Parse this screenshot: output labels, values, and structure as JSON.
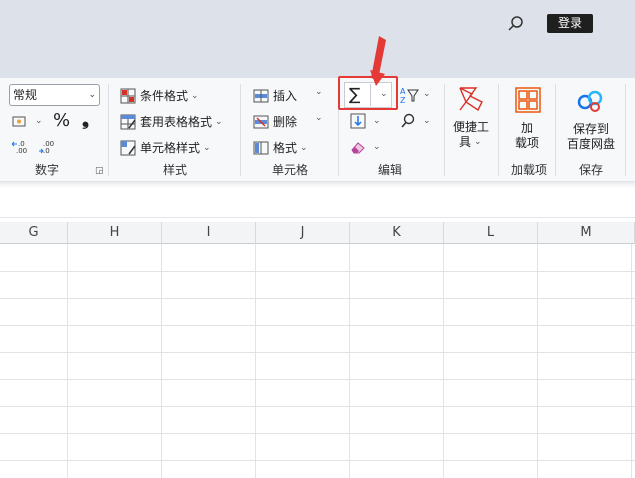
{
  "header": {
    "login_label": "登录"
  },
  "number_group": {
    "format_value": "常规",
    "percent_symbol": "%",
    "comma_symbol": "❟",
    "label": "数字"
  },
  "styles_group": {
    "items": [
      "条件格式",
      "套用表格格式",
      "单元格样式"
    ],
    "label": "样式"
  },
  "cells_group": {
    "items": [
      "插入",
      "删除",
      "格式"
    ],
    "label": "单元格"
  },
  "edit_group": {
    "sum_symbol": "∑",
    "label": "编辑"
  },
  "tools_group": {
    "quick_tools_line1": "便捷工",
    "quick_tools_line2": "具",
    "addins_line1": "加",
    "addins_line2": "载项",
    "addins_label": "加载项",
    "save_line1": "保存到",
    "save_line2": "百度网盘",
    "save_label": "保存"
  },
  "columns": [
    "G",
    "H",
    "I",
    "J",
    "K",
    "L",
    "M"
  ],
  "colors": {
    "highlight": "#e53935",
    "accent": "#1a73e8"
  }
}
